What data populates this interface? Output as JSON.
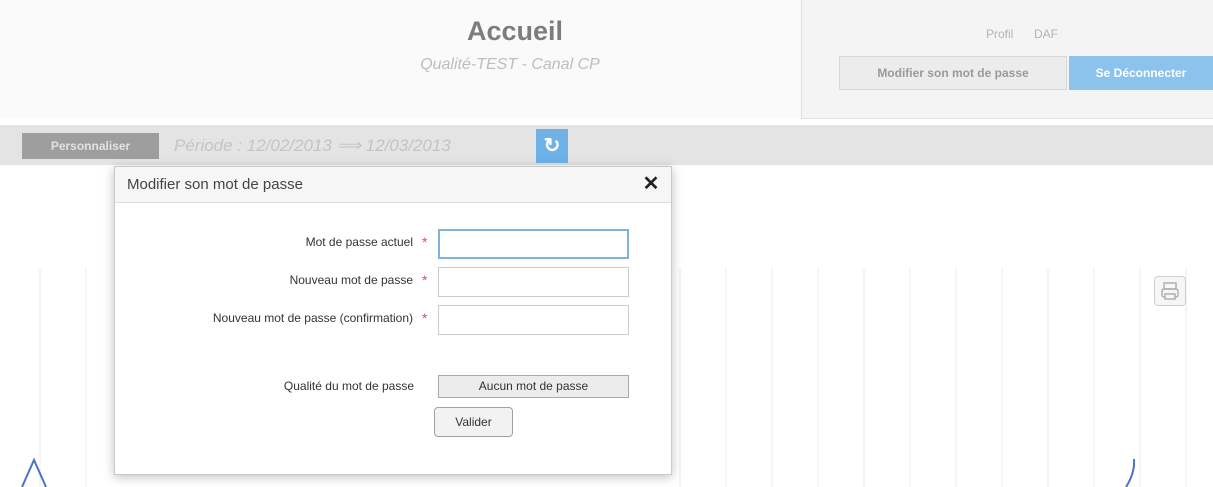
{
  "header": {
    "title": "Accueil",
    "subtitle": "Qualité-TEST  -  Canal CP"
  },
  "profile": {
    "label": "Profil",
    "value": "DAF",
    "change_password_label": "Modifier son mot de passe",
    "logout_label": "Se Déconnecter"
  },
  "toolbar": {
    "personalize_label": "Personnaliser",
    "period_text": "Période : 12/02/2013 ⟹ 12/03/2013",
    "refresh_icon": "refresh-icon",
    "print_icon": "print-icon"
  },
  "modal": {
    "title": "Modifier son mot de passe",
    "close_icon": "close-icon",
    "fields": [
      {
        "label": "Mot de passe actuel",
        "value": "",
        "required": true
      },
      {
        "label": "Nouveau mot de passe",
        "value": "",
        "required": true
      },
      {
        "label": "Nouveau mot de passe (confirmation)",
        "value": "",
        "required": true
      }
    ],
    "required_marker": "*",
    "strength_label": "Qualité du mot de passe",
    "strength_value": "Aucun mot de passe",
    "submit_label": "Valider"
  },
  "colors": {
    "accent": "#8cc3ec",
    "required": "#d9534f",
    "focus_border": "#7fb4d6"
  }
}
